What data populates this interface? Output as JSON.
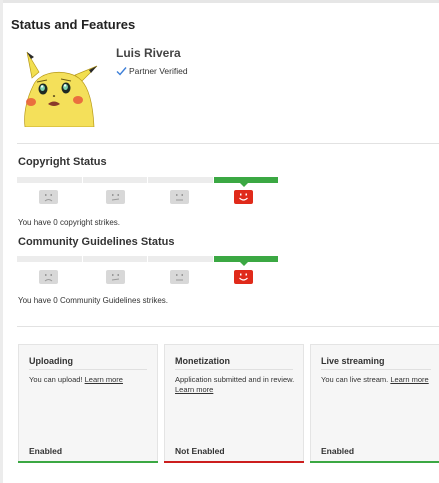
{
  "page": {
    "title": "Status and Features"
  },
  "profile": {
    "name": "Luis Rivera",
    "verified_label": "Partner Verified",
    "avatar_icon": "pikachu-avatar"
  },
  "copyright": {
    "title": "Copyright Status",
    "strikes": 0,
    "info": "You have 0 copyright strikes."
  },
  "community": {
    "title": "Community Guidelines Status",
    "strikes": 0,
    "info": "You have 0 Community Guidelines strikes."
  },
  "colors": {
    "good": "#3ba843",
    "bad": "#cc1e1e",
    "accent_check": "#3d7fd8"
  },
  "features": [
    {
      "title": "Uploading",
      "text": "You can upload! ",
      "link": "Learn more",
      "status": "Enabled",
      "state": "enabled"
    },
    {
      "title": "Monetization",
      "text": "Application submitted and in review. ",
      "link": "Learn more",
      "status": "Not Enabled",
      "state": "disabled"
    },
    {
      "title": "Live streaming",
      "text": "You can live stream. ",
      "link": "Learn more",
      "status": "Enabled",
      "state": "enabled"
    }
  ]
}
